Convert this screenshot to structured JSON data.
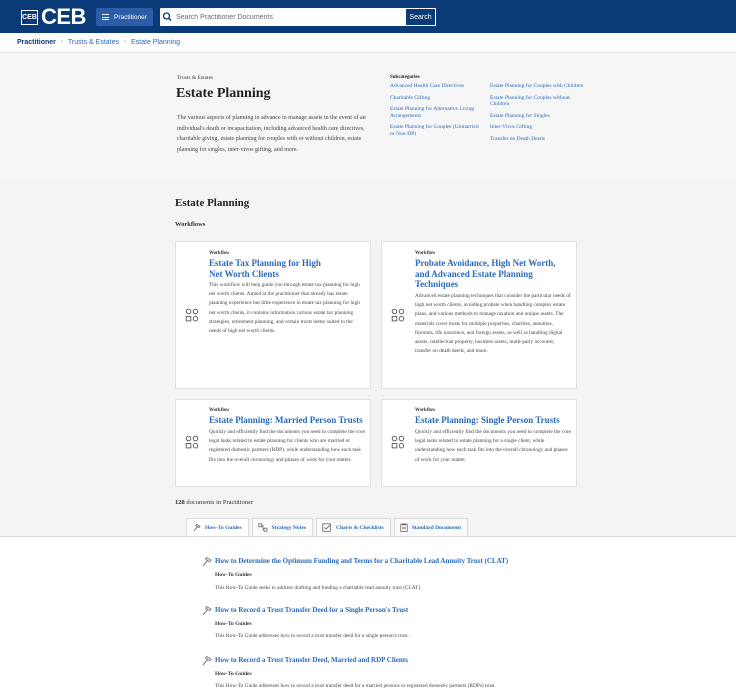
{
  "header": {
    "logo_text": "CEB",
    "logo_box_text": "CEB",
    "product_button_label": "Practitioner",
    "search_placeholder": "Search Practitioner Documents",
    "search_value": "",
    "search_button_label": "Search",
    "brand_color": "#0b3a78"
  },
  "breadcrumb": [
    "Practitioner",
    "Trusts & Estates",
    "Estate Planning"
  ],
  "hero": {
    "kicker": "Trusts & Estates",
    "title": "Estate Planning",
    "description": "The various aspects of planning in advance to manage assets in the event of an individual's death or incapacitation, including advanced health care directives, charitable giving, estate planning for couples with or without children, estate planning for singles, inter-vivos gifting, and more.",
    "subcategories_label": "Subcategories",
    "subcategories_col1": [
      "Advanced Health Care Directives",
      "Charitable Gifting",
      "Estate Planning for Alternative Living Arrangements",
      "Estate Planning for Couples (Unmarried or Non-DP)"
    ],
    "subcategories_col2": [
      "Estate Planning for Couples with Children",
      "Estate Planning for Couples without Children",
      "Estate Planning for Singles",
      "Inter-Vivos Gifting",
      "Transfer on Death Deeds"
    ]
  },
  "workflows": {
    "section_title": "Estate Planning",
    "section_subtitle": "Workflows",
    "cards": [
      {
        "kicker": "Workflow",
        "title": "Estate Tax Planning for High Net Worth Clients",
        "description": "This workflow will help guide you through estate tax planning for high net worth clients. Aimed at the practitioner that already has estate planning experience but little experience in estate tax planning for high net worth clients, it contains information various estate tax planning strategies, retirement planning, and certain trusts better suited to the needs of high net worth clients."
      },
      {
        "kicker": "Workflow",
        "title": "Probate Avoidance, High Net Worth, and Advanced Estate Planning Techniques",
        "description": "Advanced estate planning techniques that consider the particular needs of high net worth clients, avoiding probate when handling complex estate plans, and various methods to manage taxation and unique assets. The materials cover trusts for multiple properties, charities, annuities, firearms, life insurance, and foreign assets, as well as handling digital assets, intellectual property, business assets, multi-party accounts, transfer on death deeds, and more."
      },
      {
        "kicker": "Workflow",
        "title": "Estate Planning: Married Person Trusts",
        "description": "Quickly and efficiently find the documents you need to complete the core legal tasks related to estate planning for clients who are married or registered domestic partners (RDP), while understanding how each task fits into the overall chronology and phases of work for your matter."
      },
      {
        "kicker": "Workflow",
        "title": "Estate Planning: Single Person Trusts",
        "description": "Quickly and efficiently find the documents you need to complete the core legal tasks related to estate planning for a single client, while understanding how each task fits into the overall chronology and phases of work for your matter."
      }
    ]
  },
  "documents": {
    "count": "128",
    "count_suffix": "documents in Practitioner",
    "tabs": [
      {
        "label": "How-To Guides",
        "icon": "hammer-icon",
        "active": true
      },
      {
        "label": "Strategy Notes",
        "icon": "strategy-icon",
        "active": false
      },
      {
        "label": "Charts & Checklists",
        "icon": "checklist-icon",
        "active": false
      },
      {
        "label": "Standard Documents",
        "icon": "document-icon",
        "active": false
      }
    ],
    "results": [
      {
        "title": "How to Determine the Optimum Funding and Terms for a Charitable Lead Annuity Trust (CLAT)",
        "type": "How-To Guides",
        "description": "This How-To Guide seeks to address drafting and funding a charitable lead annuity trust (CLAT)."
      },
      {
        "title": "How to Record a Trust Transfer Deed for a Single Person's Trust",
        "type": "How-To Guides",
        "description": "This How-To Guide addresses how to record a trust transfer deed for a single person's trust."
      },
      {
        "title": "How to Record a Trust Transfer Deed, Married and RDP Clients",
        "type": "How-To Guides",
        "description": "This How-To Guide addresses how to record a trust transfer deed for a married persons or registered domestic partners (RDPs) trust."
      }
    ]
  }
}
